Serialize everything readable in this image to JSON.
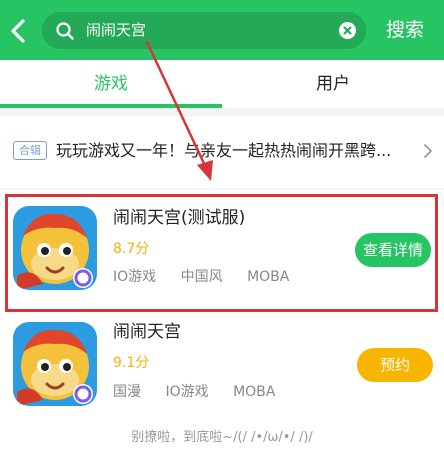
{
  "header": {
    "search_value": "闹闹天宫",
    "search_button": "搜索"
  },
  "tabs": [
    {
      "label": "游戏",
      "active": true
    },
    {
      "label": "用户",
      "active": false
    }
  ],
  "collection": {
    "badge": "合辑",
    "text": "玩玩游戏又一年！与亲友一起热热闹闹开黑跨..."
  },
  "games": [
    {
      "title": "闹闹天宫(测试服)",
      "score": "8.7分",
      "tags": [
        "IO游戏",
        "中国风",
        "MOBA"
      ],
      "action": "查看详情"
    },
    {
      "title": "闹闹天宫",
      "score": "9.1分",
      "tags": [
        "国漫",
        "IO游戏",
        "MOBA"
      ],
      "action": "预约"
    }
  ],
  "footer": "别撩啦，到底啦~/(/ /•/ω/•/ /)/",
  "colors": {
    "brand_green": "#27c464",
    "reserve_orange": "#f7b500",
    "score_yellow": "#f5b400",
    "annotation_red": "#d8343a"
  }
}
